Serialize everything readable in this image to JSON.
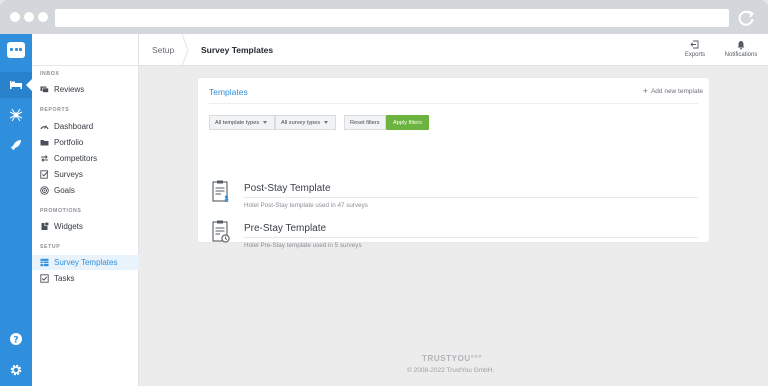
{
  "app": {
    "breadcrumb": {
      "section": "Setup",
      "title": "Survey Templates"
    },
    "top_actions": {
      "exports": "Exports",
      "notifications": "Notifications"
    }
  },
  "sidebar": {
    "inbox": {
      "title": "INBOX",
      "items": [
        {
          "label": "Reviews",
          "icon": "inbox-icon"
        }
      ]
    },
    "reports": {
      "title": "REPORTS",
      "items": [
        {
          "label": "Dashboard",
          "icon": "gauge-icon"
        },
        {
          "label": "Portfolio",
          "icon": "folder-icon"
        },
        {
          "label": "Competitors",
          "icon": "arrows-icon"
        },
        {
          "label": "Surveys",
          "icon": "survey-icon"
        },
        {
          "label": "Goals",
          "icon": "target-icon"
        }
      ]
    },
    "promotions": {
      "title": "PROMOTIONS",
      "items": [
        {
          "label": "Widgets",
          "icon": "widget-icon"
        }
      ]
    },
    "setup": {
      "title": "SETUP",
      "items": [
        {
          "label": "Survey Templates",
          "icon": "table-icon",
          "active": true
        },
        {
          "label": "Tasks",
          "icon": "checkbox-icon"
        }
      ]
    }
  },
  "templates_card": {
    "title": "Templates",
    "add_label": "Add new template",
    "filters": {
      "template_type": "All template types",
      "survey_type": "All survey types",
      "reset": "Reset filters",
      "apply": "Apply filters"
    },
    "items": [
      {
        "name": "Post-Stay Template",
        "description": "Hotel Post-Stay template used in 47 surveys",
        "icon": "clipboard-person-icon"
      },
      {
        "name": "Pre-Stay Template",
        "description": "Hotel Pre-Stay template used in 5 surveys",
        "icon": "clipboard-clock-icon"
      }
    ]
  },
  "footer": {
    "brand": "TRUSTYOU°°°",
    "copyright": "© 2008-2022 TrustYou GmbH."
  },
  "colors": {
    "accent": "#2f8fdc",
    "apply": "#6cb33f"
  }
}
